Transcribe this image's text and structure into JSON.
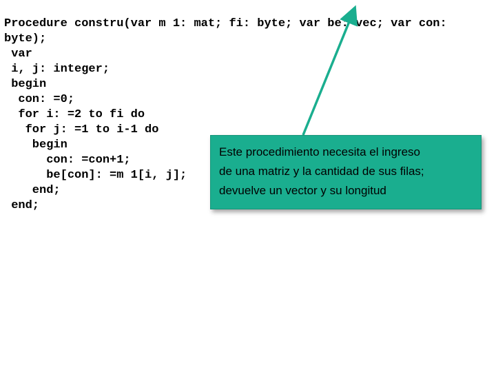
{
  "code": {
    "l1": "Procedure constru(var m 1: mat; fi: byte; var be: vec; var con:",
    "l2": "byte);",
    "l3": " var",
    "l4": " i, j: integer;",
    "l5": " begin",
    "l6": "  con: =0;",
    "l7": "  for i: =2 to fi do",
    "l8": "   for j: =1 to i-1 do",
    "l9": "    begin",
    "l10": "      con: =con+1;",
    "l11": "      be[con]: =m 1[i, j];",
    "l12": "    end;",
    "l13": " end;"
  },
  "callout": {
    "line1": "Este procedimiento necesita el ingreso",
    "line2": "de una matriz y la cantidad de sus filas;",
    "line3": "devuelve un vector y su longitud"
  },
  "colors": {
    "callout_bg": "#1aae8f",
    "arrow": "#1aae8f"
  }
}
